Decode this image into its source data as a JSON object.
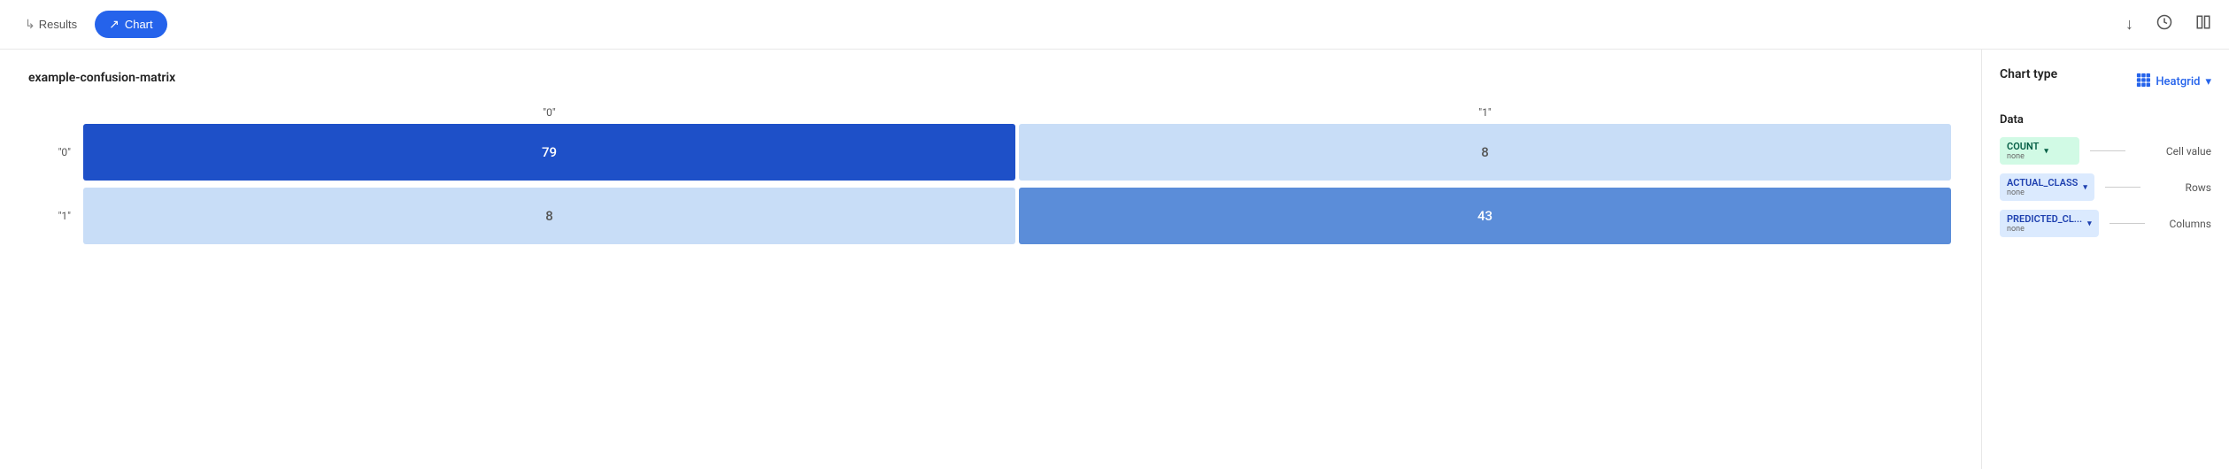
{
  "topbar": {
    "results_label": "Results",
    "chart_label": "Chart",
    "download_icon": "↓",
    "clock_icon": "⏱",
    "layout_icon": "⊞"
  },
  "chart": {
    "title": "example-confusion-matrix",
    "columns": [
      "\"0\"",
      "\"1\""
    ],
    "rows": [
      {
        "label": "\"0\"",
        "cells": [
          {
            "value": 79,
            "style": "dark-blue"
          },
          {
            "value": 8,
            "style": "light-blue"
          }
        ]
      },
      {
        "label": "\"1\"",
        "cells": [
          {
            "value": 8,
            "style": "light-blue"
          },
          {
            "value": 43,
            "style": "medium-blue"
          }
        ]
      }
    ]
  },
  "sidebar": {
    "chart_type_label": "Chart type",
    "heatgrid_label": "Heatgrid",
    "data_label": "Data",
    "data_rows": [
      {
        "tag_label": "COUNT",
        "tag_sub": "none",
        "tag_style": "green",
        "row_label": "Cell value"
      },
      {
        "tag_label": "ACTUAL_CLASS",
        "tag_sub": "none",
        "tag_style": "blue1",
        "row_label": "Rows"
      },
      {
        "tag_label": "PREDICTED_CL...",
        "tag_sub": "none",
        "tag_style": "blue2",
        "row_label": "Columns"
      }
    ]
  }
}
